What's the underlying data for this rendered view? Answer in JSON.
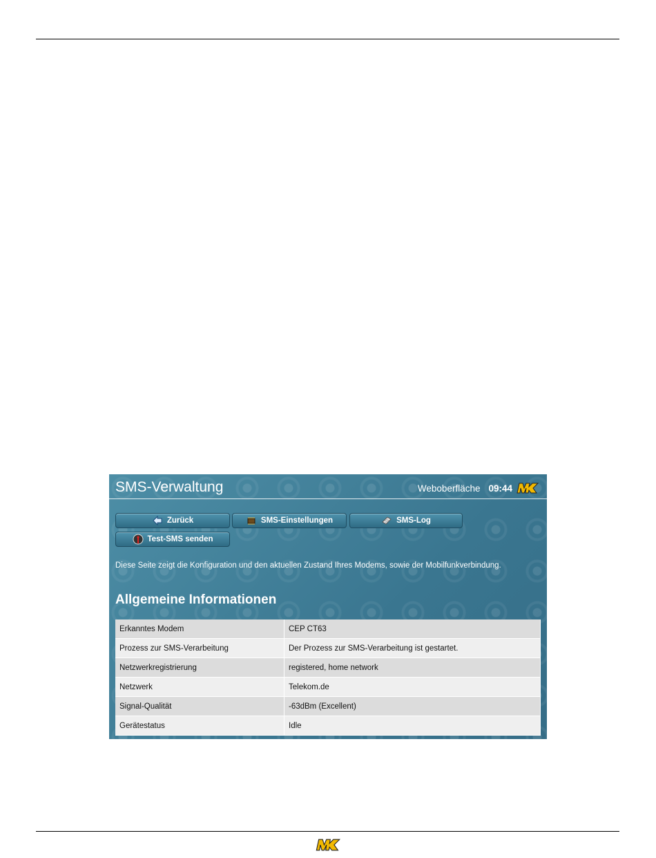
{
  "app": {
    "title": "SMS-Verwaltung",
    "subtitle": "Weboberfläche",
    "time": "09:44",
    "logo_text": "MK"
  },
  "toolbar": {
    "back_label": "Zurück",
    "settings_label": "SMS-Einstellungen",
    "log_label": "SMS-Log",
    "test_label": "Test-SMS senden"
  },
  "description": "Diese Seite zeigt die Konfiguration und den aktuellen Zustand Ihres Modems, sowie der Mobilfunkverbindung.",
  "section": {
    "title": "Allgemeine Informationen",
    "rows": [
      {
        "key": "Erkanntes Modem",
        "value": "CEP CT63"
      },
      {
        "key": "Prozess zur SMS-Verarbeitung",
        "value": "Der Prozess zur SMS-Verarbeitung ist gestartet."
      },
      {
        "key": "Netzwerkregistrierung",
        "value": "registered, home network"
      },
      {
        "key": "Netzwerk",
        "value": "Telekom.de"
      },
      {
        "key": "Signal-Qualität",
        "value": "-63dBm (Excellent)"
      },
      {
        "key": "Gerätestatus",
        "value": "Idle"
      }
    ]
  },
  "colors": {
    "panel_bg": "#3f7f98",
    "logo_yellow": "#f2b900"
  },
  "icons": {
    "back": "arrow-left-icon",
    "settings": "chip-icon",
    "log": "document-icon",
    "test": "antenna-icon"
  }
}
